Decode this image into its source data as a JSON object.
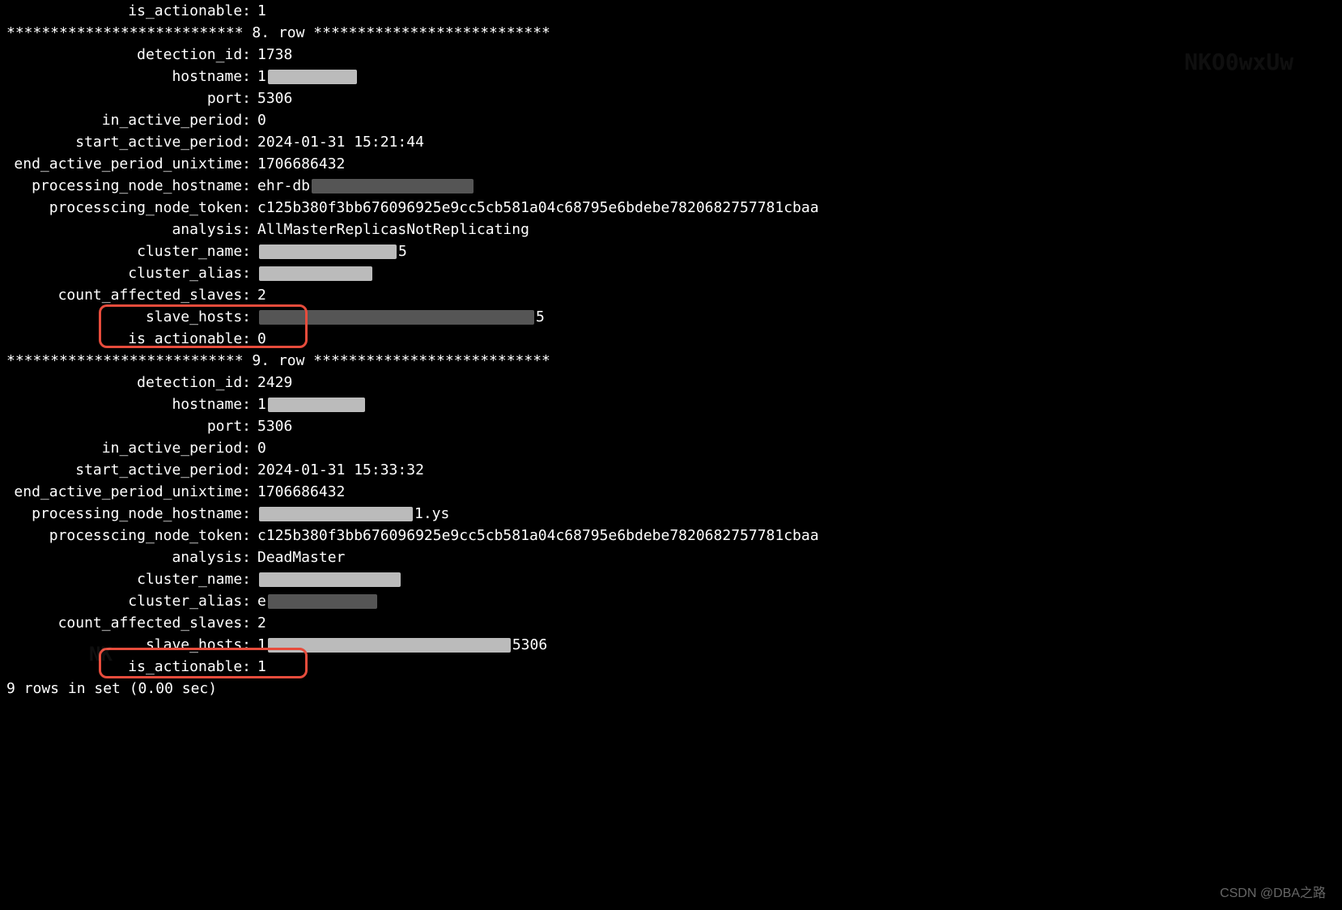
{
  "watermark_top": "NKO0wxUw",
  "watermark_left": "NK",
  "row7_tail": {
    "is_actionable_label": "is_actionable:",
    "is_actionable_value": "1"
  },
  "separator_8": "*************************** 8. row ***************************",
  "row8": {
    "detection_id_label": "detection_id:",
    "detection_id_value": "1738",
    "hostname_label": "hostname:",
    "hostname_value_prefix": "1",
    "port_label": "port:",
    "port_value": "5306",
    "in_active_period_label": "in_active_period:",
    "in_active_period_value": "0",
    "start_active_period_label": "start_active_period:",
    "start_active_period_value": "2024-01-31 15:21:44",
    "end_active_period_unixtime_label": "end_active_period_unixtime:",
    "end_active_period_unixtime_value": "1706686432",
    "processing_node_hostname_label": "processing_node_hostname:",
    "processing_node_hostname_value_prefix": "ehr-db",
    "processcing_node_token_label": "processcing_node_token:",
    "processcing_node_token_value": "c125b380f3bb676096925e9cc5cb581a04c68795e6bdebe7820682757781cbaa",
    "analysis_label": "analysis:",
    "analysis_value": "AllMasterReplicasNotReplicating",
    "cluster_name_label": "cluster_name:",
    "cluster_name_suffix": "5",
    "cluster_alias_label": "cluster_alias:",
    "count_affected_slaves_label": "count_affected_slaves:",
    "count_affected_slaves_value": "2",
    "slave_hosts_label": "slave_hosts:",
    "slave_hosts_suffix": "5",
    "is_actionable_label": "is_actionable:",
    "is_actionable_value": "0"
  },
  "separator_9": "*************************** 9. row ***************************",
  "row9": {
    "detection_id_label": "detection_id:",
    "detection_id_value": "2429",
    "hostname_label": "hostname:",
    "hostname_value_prefix": "1",
    "port_label": "port:",
    "port_value": "5306",
    "in_active_period_label": "in_active_period:",
    "in_active_period_value": "0",
    "start_active_period_label": "start_active_period:",
    "start_active_period_value": "2024-01-31 15:33:32",
    "end_active_period_unixtime_label": "end_active_period_unixtime:",
    "end_active_period_unixtime_value": "1706686432",
    "processing_node_hostname_label": "processing_node_hostname:",
    "processing_node_hostname_suffix": "1.ys",
    "processcing_node_token_label": "processcing_node_token:",
    "processcing_node_token_value": "c125b380f3bb676096925e9cc5cb581a04c68795e6bdebe7820682757781cbaa",
    "analysis_label": "analysis:",
    "analysis_value": "DeadMaster",
    "cluster_name_label": "cluster_name:",
    "cluster_alias_label": "cluster_alias:",
    "cluster_alias_prefix": "e",
    "count_affected_slaves_label": "count_affected_slaves:",
    "count_affected_slaves_value": "2",
    "slave_hosts_label": "slave_hosts:",
    "slave_hosts_prefix": "1",
    "slave_hosts_suffix": "5306",
    "is_actionable_label": "is_actionable:",
    "is_actionable_value": "1"
  },
  "footer": "9 rows in set (0.00 sec)",
  "attribution": "CSDN @DBA之路"
}
